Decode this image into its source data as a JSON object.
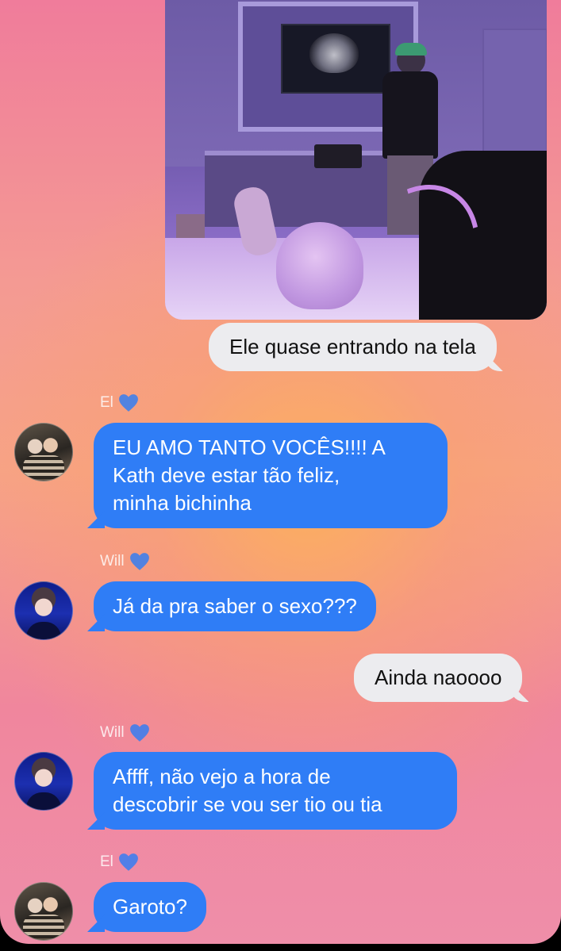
{
  "photo": {
    "description_icon": "ultrasound-photo"
  },
  "messages": [
    {
      "type": "sent",
      "text": "Ele quase entrando na tela"
    },
    {
      "type": "received",
      "sender": "El",
      "text_lines": [
        "EU AMO TANTO VOCÊS!!!! A",
        "Kath deve estar tão feliz,",
        "minha bichinha"
      ]
    },
    {
      "type": "received",
      "sender": "Will",
      "text": "Já da pra saber o sexo???"
    },
    {
      "type": "sent",
      "text": "Ainda naoooo"
    },
    {
      "type": "received",
      "sender": "Will",
      "text_lines": [
        "Affff, não vejo a hora de",
        "descobrir se vou ser tio ou tia"
      ]
    },
    {
      "type": "received",
      "sender": "El",
      "text": "Garoto?"
    }
  ],
  "colors": {
    "received_bubble": "#2f7df6",
    "sent_bubble": "#ececef",
    "heart": "#2f7df6"
  },
  "icons": {
    "sender_badge": "blue-heart-icon"
  }
}
